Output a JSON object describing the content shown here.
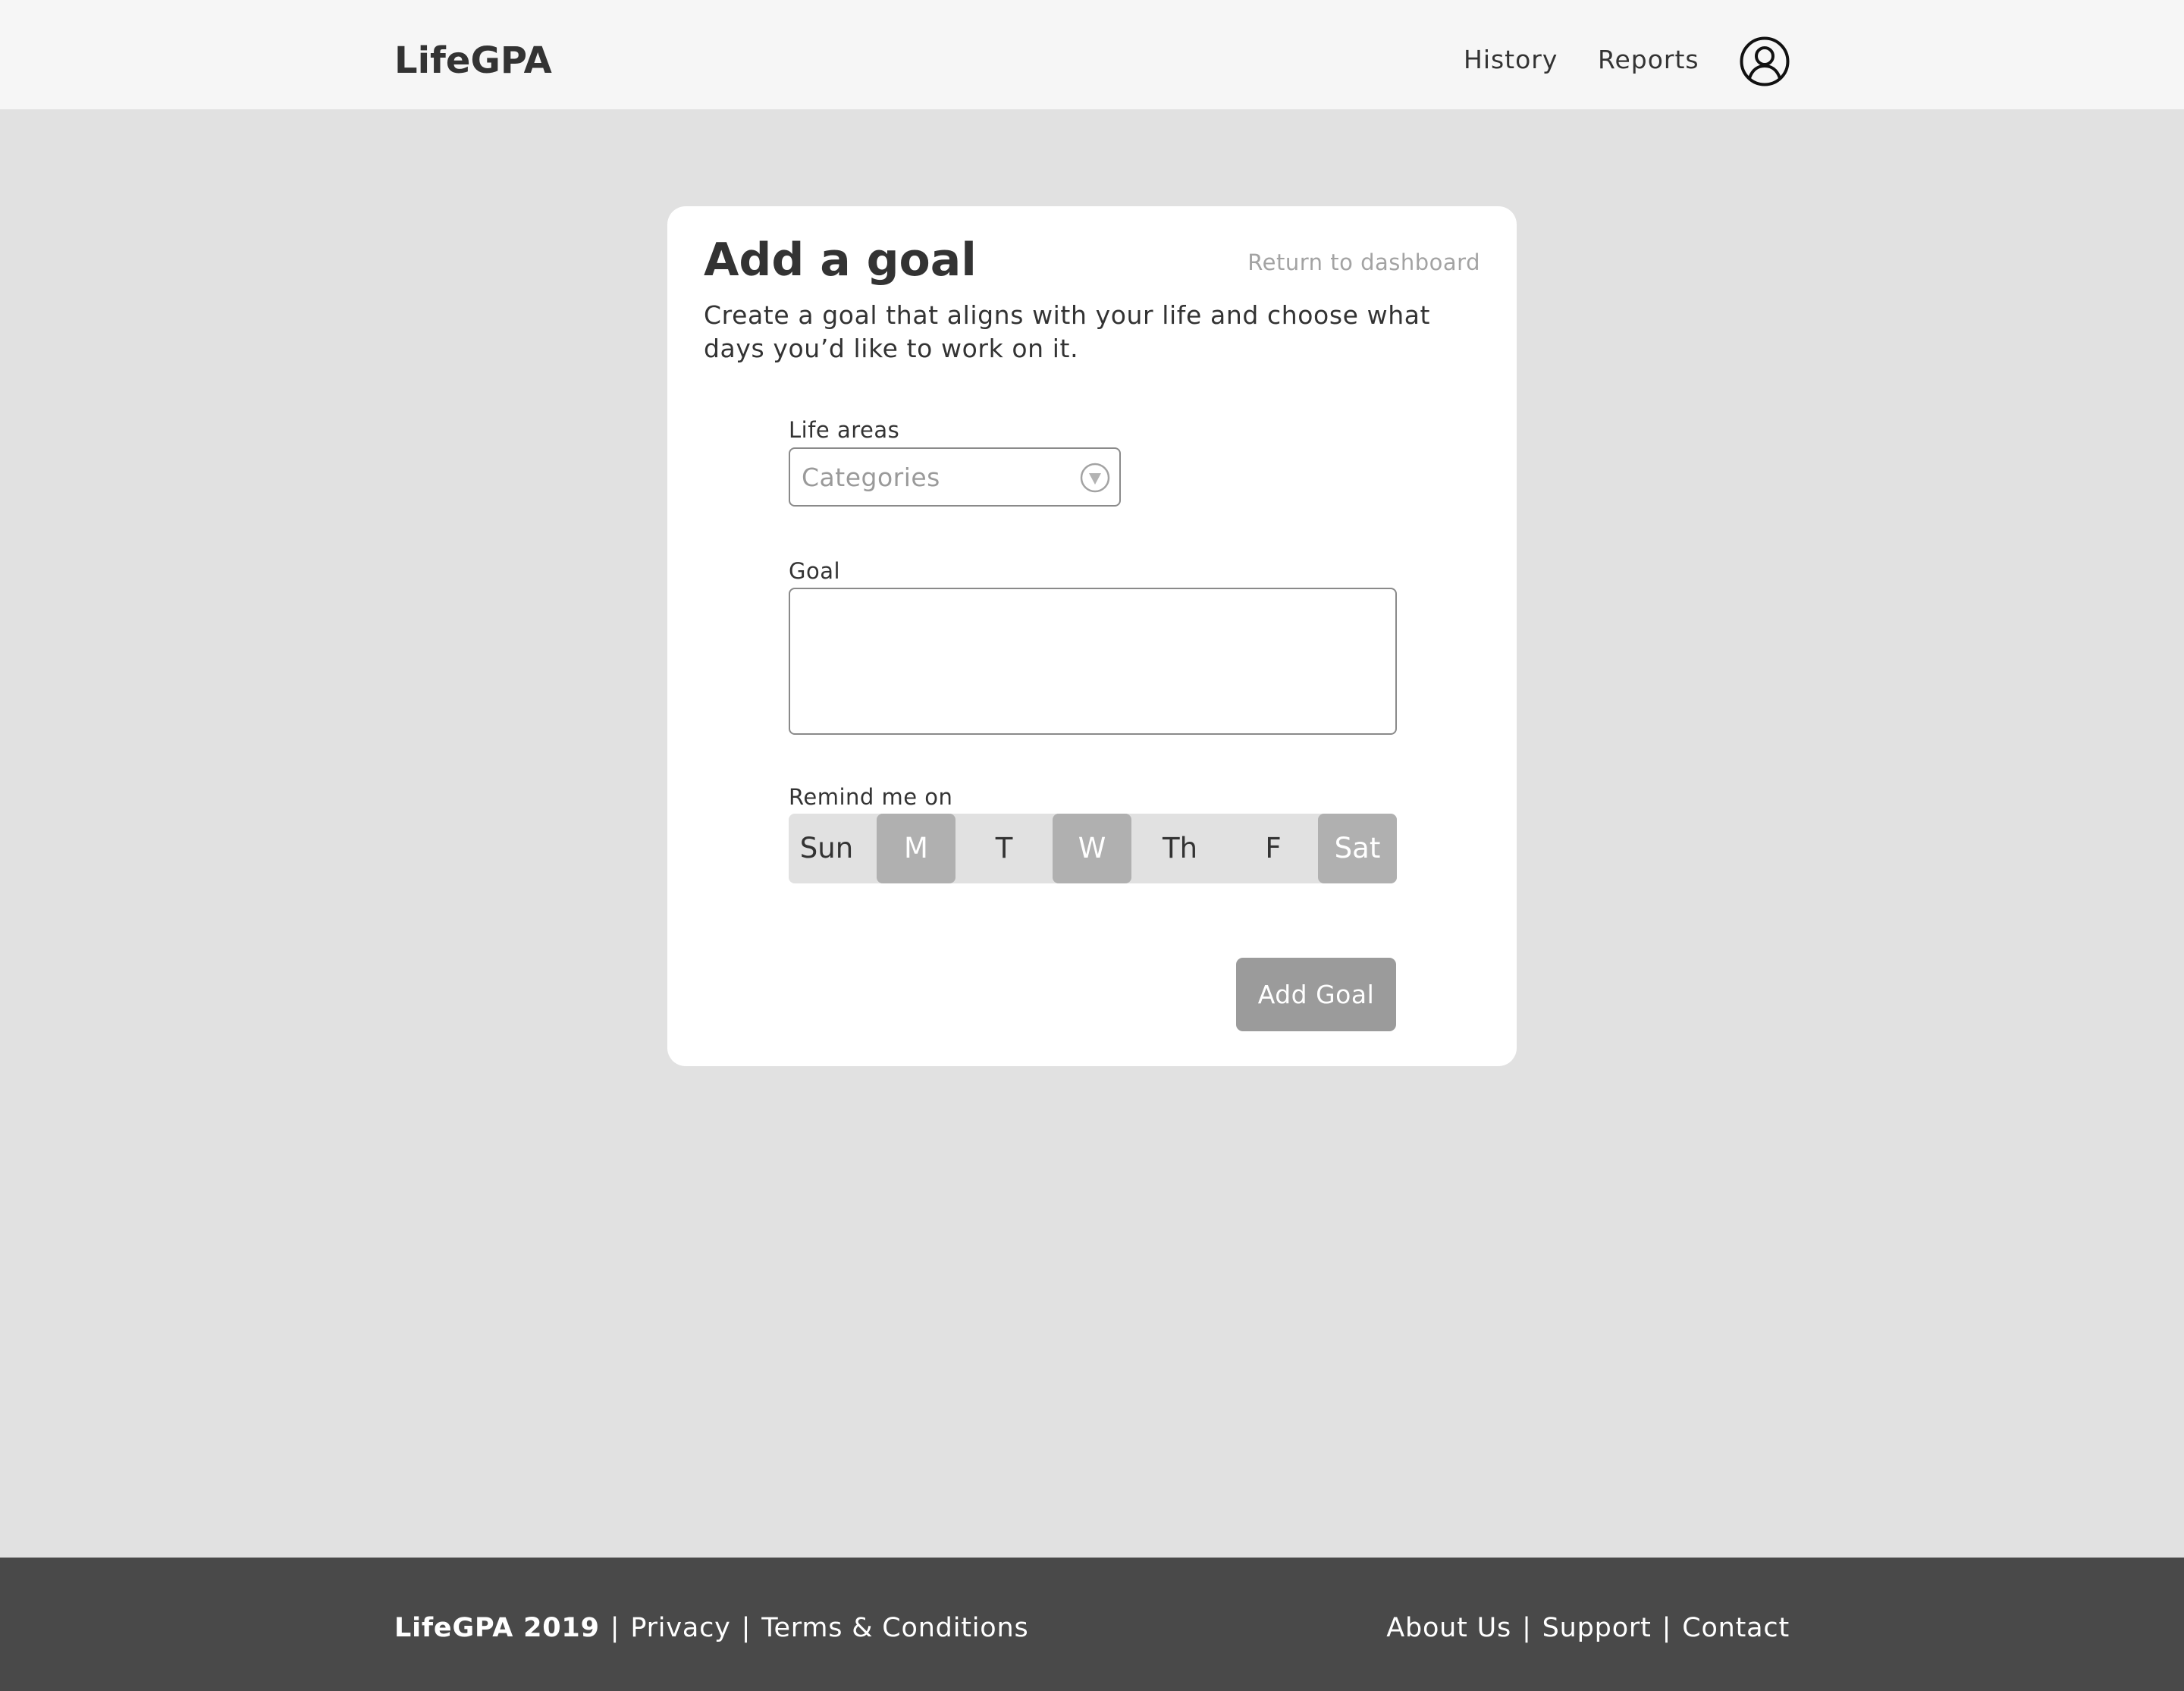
{
  "header": {
    "logo": "LifeGPA",
    "nav": {
      "history": "History",
      "reports": "Reports"
    },
    "avatar_icon": "user-circle-icon"
  },
  "card": {
    "title": "Add a goal",
    "return_link": "Return to dashboard",
    "description": "Create a goal that aligns with your life and choose what days you’d like to work on it."
  },
  "form": {
    "life_areas": {
      "label": "Life areas",
      "placeholder": "Categories",
      "icon": "chevron-down-circle-icon"
    },
    "goal": {
      "label": "Goal",
      "value": ""
    },
    "remind": {
      "label": "Remind me on",
      "days": [
        {
          "label": "Sun",
          "selected": false
        },
        {
          "label": "M",
          "selected": true
        },
        {
          "label": "T",
          "selected": false
        },
        {
          "label": "W",
          "selected": true
        },
        {
          "label": "Th",
          "selected": false
        },
        {
          "label": "F",
          "selected": false
        },
        {
          "label": "Sat",
          "selected": true
        }
      ]
    },
    "submit_label": "Add Goal"
  },
  "footer": {
    "brand": "LifeGPA 2019",
    "left_links": [
      "Privacy",
      "Terms & Conditions"
    ],
    "right_links": [
      "About Us",
      "Support",
      "Contact"
    ],
    "separator": "|"
  },
  "colors": {
    "page_background": "#e1e1e1",
    "header_background": "#f6f6f6",
    "footer_background": "#494949",
    "selected_day": "#b0b0b0",
    "button": "#9b9b9b"
  }
}
